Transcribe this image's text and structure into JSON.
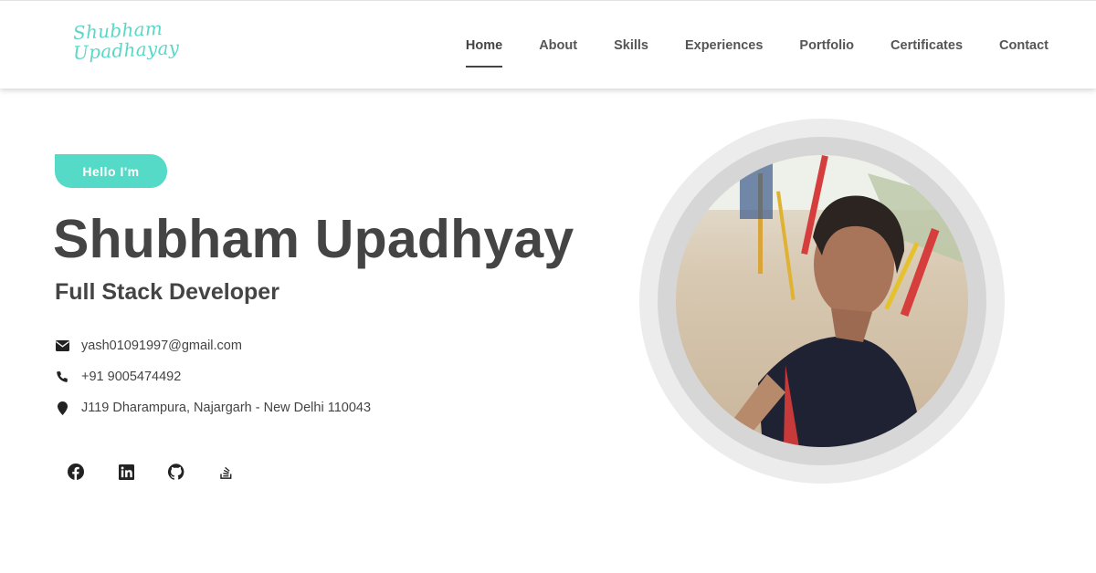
{
  "header": {
    "logo": {
      "line1": "Shubham",
      "line2": "Upadhayay"
    },
    "nav": [
      {
        "label": "Home",
        "active": true
      },
      {
        "label": "About"
      },
      {
        "label": "Skills"
      },
      {
        "label": "Experiences"
      },
      {
        "label": "Portfolio"
      },
      {
        "label": "Certificates"
      },
      {
        "label": "Contact"
      }
    ]
  },
  "hero": {
    "badge": "Hello I'm",
    "name": "Shubham Upadhyay",
    "role": "Full Stack Developer",
    "contact": {
      "email": "yash01091997@gmail.com",
      "phone": "+91 9005474492",
      "address": "J119 Dharampura, Najargarh - New Delhi 110043"
    },
    "socials": [
      {
        "icon": "facebook-icon"
      },
      {
        "icon": "linkedin-icon"
      },
      {
        "icon": "github-icon"
      },
      {
        "icon": "stackoverflow-icon"
      }
    ]
  },
  "colors": {
    "accent": "#55dac7",
    "text": "#444444",
    "ring_outer": "#ececec",
    "ring_inner": "#d6d6d6"
  }
}
